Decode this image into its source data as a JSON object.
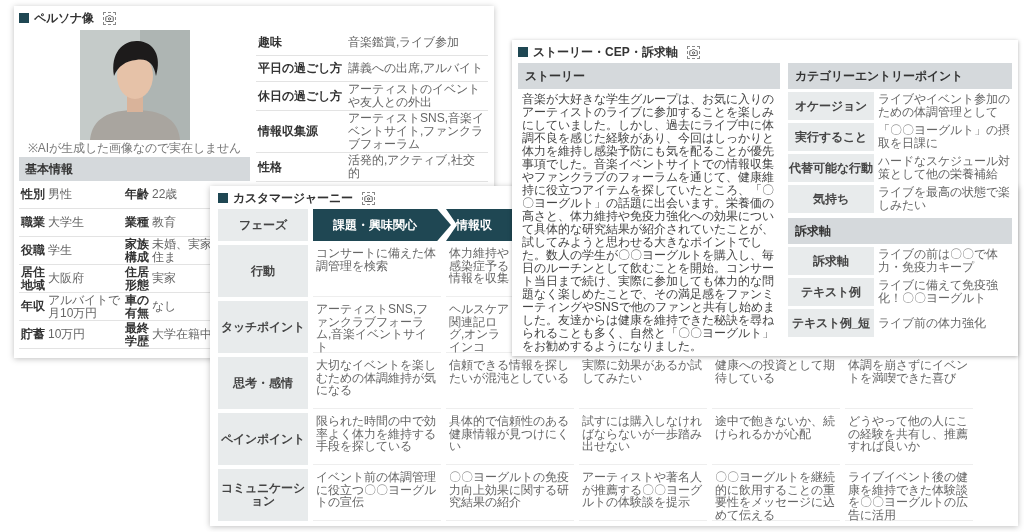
{
  "persona": {
    "title": "ペルソナ像",
    "caption": "※AIが生成した画像なので実在しません",
    "basic_info": {
      "heading": "基本情報",
      "rows": [
        {
          "label": "性別",
          "value": "男性",
          "label_2": "年齢",
          "value_2": "22歳"
        },
        {
          "label": "職業",
          "value": "大学生",
          "label_2": "業種",
          "value_2": "教育"
        },
        {
          "label": "役職",
          "value": "学生",
          "label_2": "家族構成",
          "value_2": "未婚、実家住ま"
        },
        {
          "label": "居住地域",
          "value": "大阪府",
          "label_2": "住居形態",
          "value_2": "実家"
        },
        {
          "label": "年収",
          "value": "アルバイトで月10万円",
          "label_2": "車の有無",
          "value_2": "なし"
        },
        {
          "label": "貯蓄",
          "value": "10万円",
          "label_2": "最終学歴",
          "value_2": "大学在籍中"
        }
      ]
    },
    "profile": [
      {
        "label": "趣味",
        "value": "音楽鑑賞,ライブ参加"
      },
      {
        "label": "平日の過ごし方",
        "value": "講義への出席,アルバイト"
      },
      {
        "label": "休日の過ごし方",
        "value": "アーティストのイベントや友人との外出"
      },
      {
        "label": "情報収集源",
        "value": "アーティストSNS,音楽イベントサイト,ファンクラブフォーラム"
      },
      {
        "label": "性格",
        "value": "活発的,アクティブ,社交的"
      }
    ]
  },
  "journey": {
    "title": "カスタマージャーニー",
    "phase_label": "フェーズ",
    "phases": [
      "課題・興味関心",
      "情報収"
    ],
    "rows": [
      {
        "label": "行動",
        "cells": [
          "コンサートに備えた体調管理を検索",
          "体力維持や感染症予る情報を収集"
        ]
      },
      {
        "label": "タッチポイント",
        "cells": [
          "アーティストSNS,ファンクラブフォーラム,音楽イベントサイト",
          "ヘルスケア関連記ログ,オンラインコ"
        ]
      },
      {
        "label": "思考・感情",
        "cells": [
          "大切なイベントを楽しむための体調維持が気になる",
          "信頼できる情報を探したいが混沌としている",
          "実際に効果があるか試してみたい",
          "健康への投資として期待している",
          "体調を崩さずにイベントを満喫できた喜び"
        ]
      },
      {
        "label": "ペインポイント",
        "cells": [
          "限られた時間の中で効率よく体力を維持する手段を探している",
          "具体的で信頼性のある健康情報が見つけにくい",
          "試すには購入しなければならないが一歩踏み出せない",
          "途中で飽きないか、続けられるかが心配",
          "どうやって他の人にこの経験を共有し、推薦すれば良いか"
        ]
      },
      {
        "label": "コミュニケーション",
        "cells": [
          "イベント前の体調管理に役立つ〇〇ヨーグルトの宣伝",
          "〇〇ヨーグルトの免疫力向上効果に関する研究結果の紹介",
          "アーティストや著名人が推薦する〇〇ヨーグルトの体験談を提示",
          "〇〇ヨーグルトを継続的に飲用することの重要性をメッセージに込めて伝える",
          "ライブイベント後の健康を維持できた体験談を〇〇ヨーグルトの広告に活用"
        ]
      }
    ]
  },
  "story_sheet": {
    "title": "ストーリー・CEP・訴求軸",
    "story": {
      "heading": "ストーリー",
      "text": "音楽が大好きな学生グループは、お気に入りのアーティストのライブに参加することを楽しみにしていました。しかし、過去にライブ中に体調不良を感じた経験があり、今回はしっかりと体力を維持し感染予防にも気を配ることが優先事項でした。音楽イベントサイトでの情報収集やファンクラブのフォーラムを通じて、健康維持に役立つアイテムを探していたところ、「〇〇ヨーグルト」の話題に出会います。栄養価の高さと、体力維持や免疫力強化への効果について具体的な研究結果が紹介されていたことが、試してみようと思わせる大きなポイントでした。数人の学生が〇〇ヨーグルトを購入し、毎日のルーチンとして飲むことを開始。コンサート当日まで続け、実際に参加しても体力的な問題なく楽しめたことで、その満足感をファンミーティングやSNSで他のファンと共有し始めました。友達からは健康を維持できた秘訣を尋ねられることも多く、自然と「〇〇ヨーグルト」をお勧めするようになりました。"
    },
    "sections": [
      {
        "heading": "カテゴリーエントリーポイント",
        "rows": [
          {
            "label": "オケージョン",
            "value": "ライブやイベント参加のための体調管理として"
          },
          {
            "label": "実行すること",
            "value": "「〇〇ヨーグルト」の摂取を日課に"
          },
          {
            "label": "代替可能な行動",
            "value": "ハードなスケジュール対策として他の栄養補給"
          },
          {
            "label": "気持ち",
            "value": "ライブを最高の状態で楽しみたい"
          }
        ]
      },
      {
        "heading": "訴求軸",
        "rows": [
          {
            "label": "訴求軸",
            "value": "ライブの前は〇〇で体力・免疫力キープ"
          },
          {
            "label": "テキスト例",
            "value": "ライブに備えて免疫強化！〇〇ヨーグルト"
          },
          {
            "label": "テキスト例_短",
            "value": "ライブ前の体力強化"
          }
        ]
      }
    ]
  }
}
